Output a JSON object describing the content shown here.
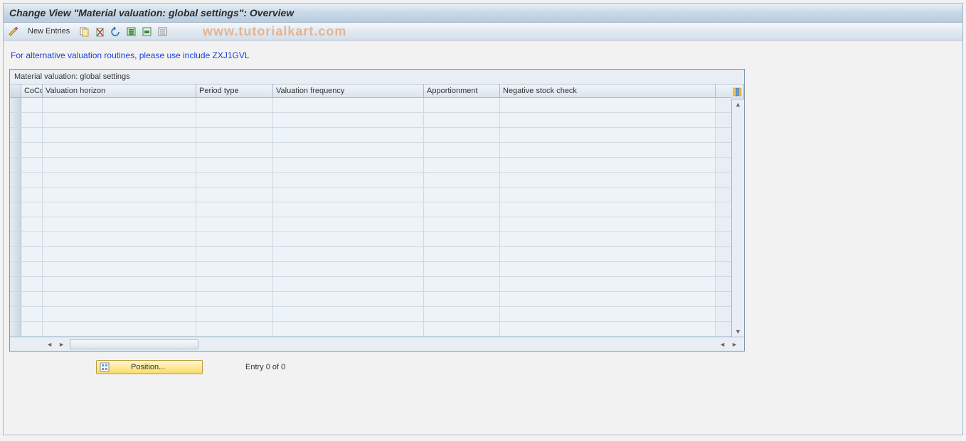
{
  "header": {
    "title": "Change View \"Material valuation: global settings\": Overview"
  },
  "toolbar": {
    "new_entries_label": "New Entries"
  },
  "info": {
    "text": "For alternative valuation routines, please use include ZXJ1GVL"
  },
  "table": {
    "title": "Material valuation: global settings",
    "columns": {
      "cocd": "CoCd",
      "valuation_horizon": "Valuation horizon",
      "period_type": "Period type",
      "valuation_frequency": "Valuation frequency",
      "apportionment": "Apportionment",
      "negative_stock_check": "Negative stock check"
    },
    "row_count": 16
  },
  "footer": {
    "position_label": "Position...",
    "entry_text": "Entry 0 of 0"
  },
  "watermark": "www.tutorialkart.com"
}
